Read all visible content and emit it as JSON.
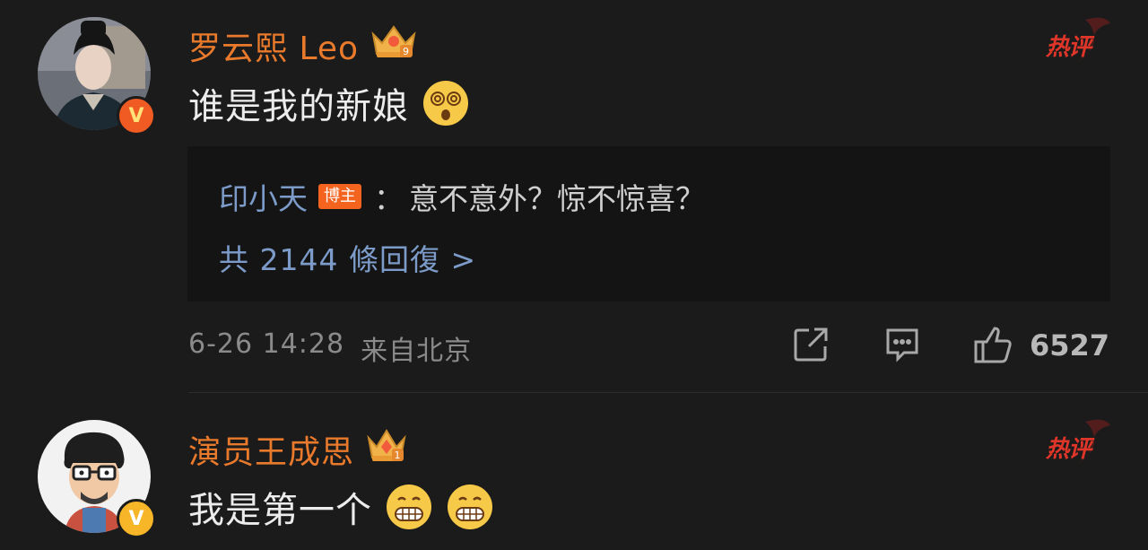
{
  "comments": [
    {
      "username": "罗云熙 Leo",
      "crown_level": "9",
      "hot_label": "热评",
      "text": "谁是我的新娘",
      "emoji_names": [
        "dizzy-face"
      ],
      "badge_letter": "V",
      "reply": {
        "name": "印小天",
        "tag": "博主",
        "separator": "：",
        "text": "意不意外？惊不惊喜？",
        "more": "共 2144 條回復 >"
      },
      "date": "6-26 14:28",
      "location": "来自北京",
      "likes": "6527"
    },
    {
      "username": "演员王成思",
      "crown_level": "1",
      "hot_label": "热评",
      "text": "我是第一个",
      "emoji_names": [
        "grinning-face",
        "grinning-face"
      ],
      "badge_letter": "V"
    }
  ],
  "icons": {
    "share": "share-icon",
    "comment": "comment-icon",
    "like": "thumbs-up-icon"
  },
  "colors": {
    "background": "#1b1b1b",
    "username": "#e97a2c",
    "link": "#7c9bc9",
    "hot": "#e0362a",
    "tag": "#f5641e"
  }
}
